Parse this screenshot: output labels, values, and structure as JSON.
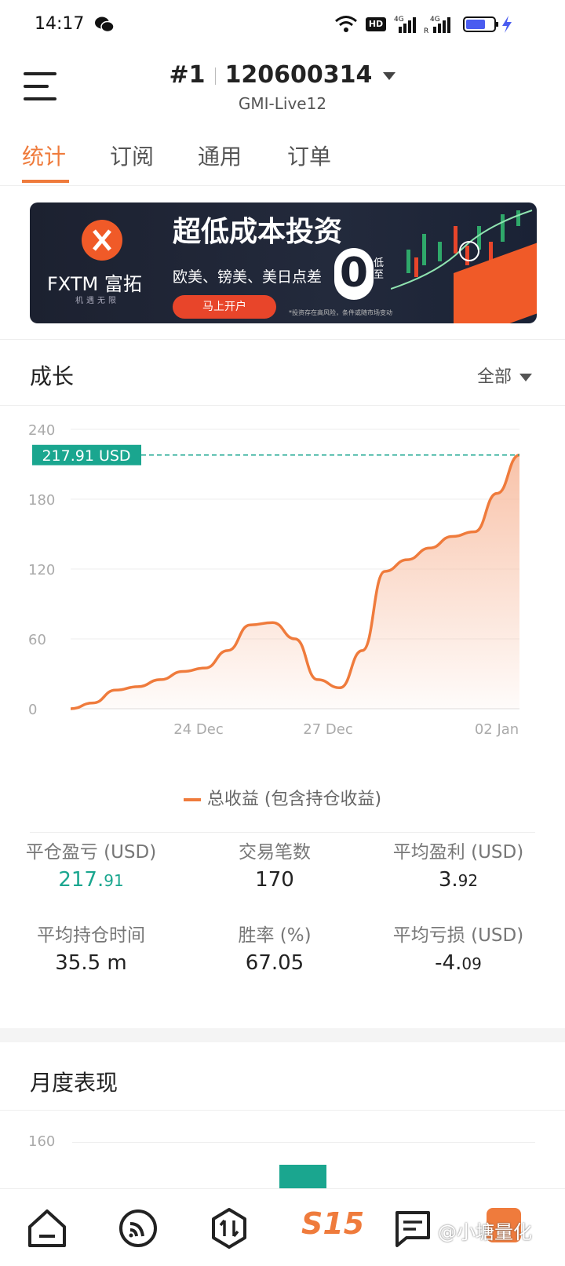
{
  "status_bar": {
    "time": "14:17",
    "icons": [
      "wechat-icon",
      "wifi-icon",
      "hd-icon",
      "signal-4g-icon",
      "signal-4g-r-icon",
      "battery-icon",
      "charging-icon"
    ]
  },
  "header": {
    "account_index": "#1",
    "account_number": "120600314",
    "server": "GMI-Live12"
  },
  "tabs": [
    {
      "label": "统计",
      "active": true
    },
    {
      "label": "订阅",
      "active": false
    },
    {
      "label": "通用",
      "active": false
    },
    {
      "label": "订单",
      "active": false
    }
  ],
  "banner": {
    "brand": "FXTM 富拓",
    "slogan": "机遇无限",
    "headline": "超低成本投资",
    "sub": "欧美、镑美、美日点差",
    "zero": "0",
    "zero_label": "低至",
    "cta": "马上开户",
    "disclaimer": "*投资存在高风险，条件或随市场变动"
  },
  "growth": {
    "title": "成长",
    "range": "全部",
    "legend": "总收益 (包含持仓收益)"
  },
  "chart_data": {
    "type": "area",
    "ylim": [
      0,
      240
    ],
    "yticks": [
      "0",
      "60",
      "120",
      "180",
      "240"
    ],
    "xticks": [
      "24 Dec",
      "27 Dec",
      "02 Jan"
    ],
    "current_label": "217.91 USD",
    "current_value": 217.91,
    "series": [
      {
        "name": "总收益 (包含持仓收益)",
        "values": [
          0,
          5,
          16,
          19,
          25,
          32,
          35,
          50,
          72,
          74,
          60,
          25,
          18,
          50,
          118,
          128,
          138,
          148,
          152,
          185,
          217.91
        ]
      }
    ],
    "colors": {
      "line": "#ef7b3c",
      "fill": "#f7b89a",
      "current": "#1aa68f"
    }
  },
  "stats": [
    {
      "label": "平仓盈亏 (USD)",
      "value_main": "217.",
      "value_small": "91",
      "color": "#1aa68f"
    },
    {
      "label": "交易笔数",
      "value_main": "170",
      "value_small": "",
      "color": "#222222"
    },
    {
      "label": "平均盈利 (USD)",
      "value_main": "3.",
      "value_small": "92",
      "color": "#222222"
    },
    {
      "label": "平均持仓时间",
      "value_main": "35.5 m",
      "value_small": "",
      "color": "#222222"
    },
    {
      "label": "胜率 (%)",
      "value_main": "67.05",
      "value_small": "",
      "color": "#222222"
    },
    {
      "label": "平均亏损 (USD)",
      "value_main": "-4.",
      "value_small": "09",
      "color": "#222222"
    }
  ],
  "monthly": {
    "title": "月度表现",
    "tick": "160"
  },
  "bottom_nav": {
    "s15_label": "S15",
    "watermark": "@小塘量化"
  }
}
